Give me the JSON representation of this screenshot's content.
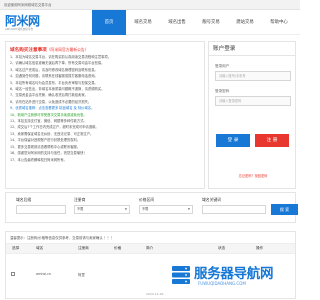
{
  "topbar": {
    "welcome": "欢迎使用阿米网络域名交易平台"
  },
  "header": {
    "logo_main": "阿米网",
    "logo_sub": "AMI.COM  域名交易平台",
    "nav": [
      "首页",
      "域名交易",
      "域名出售",
      "靓号交易",
      "建站交易",
      "帮助中心"
    ],
    "nav_active_index": 0
  },
  "info": {
    "title": "域名购买注意事项",
    "title_sub": "（阿米网官方最新公告）",
    "lines": [
      {
        "t": "1、本站为域名交易平台，请在购买前认真阅读交易流程和注意事项。",
        "c": ""
      },
      {
        "t": "2、请确认域名信息准确无误后再下单，所有交易均由平台担保。",
        "c": ""
      },
      {
        "t": "3、域名过户完成后，请及时修改域名管理密码及联系信息。",
        "c": ""
      },
      {
        "t": "4、如遇到任何问题，请联系在线客服或拨打客服电话咨询。",
        "c": ""
      },
      {
        "t": "5、本站所有域名均为会员发布，平台负责审核与担保交易。",
        "c": ""
      },
      {
        "t": "6、域名一经售出，非域名本身质量问题概不退换，请谨慎购买。",
        "c": ""
      },
      {
        "t": "7、交易资金由平台托管，确认收货后再打款给卖家。",
        "c": ""
      },
      {
        "t": "8、请勿在站外进行交易，以免造成不必要的经济损失。",
        "c": ""
      },
      {
        "t": "9、优质域名推荐：点击查看更多 精品域名 及 特价域名。",
        "c": "blue"
      },
      {
        "t": "10、新用户注册即可享受首次交易手续费减免优惠。",
        "c": "green"
      },
      {
        "t": "11、本站支持支付宝、微信、网银等多种付款方式。",
        "c": ""
      },
      {
        "t": "12、成交后7个工作日内完成过户，超时未完成可申请退款。",
        "c": ""
      },
      {
        "t": "13、卖家需保证域名无纠纷、无违法记录、可正常过户。",
        "c": ""
      },
      {
        "t": "14、平台保留对违规账户进行封禁处理的权利。",
        "c": ""
      },
      {
        "t": "15、更多交易规则请查看帮助中心或联系客服。",
        "c": ""
      },
      {
        "t": "16、感谢您对阿米网的支持与信任，祝您交易愉快！",
        "c": ""
      },
      {
        "t": "17、本公告最终解释权归阿米网所有。",
        "c": ""
      }
    ]
  },
  "login": {
    "title": "账户登录",
    "user_label": "登录用户",
    "user_placeholder": "请输入账号/手机号",
    "pass_label": "登录密码",
    "pass_placeholder": "请输入登录密码",
    "login_btn": "登 录",
    "register_btn": "注 册",
    "forgot": "忘记密码？找回密码"
  },
  "search": {
    "fields": [
      {
        "label": "域名后缀"
      },
      {
        "label": "注册商"
      },
      {
        "label": "价格区间"
      },
      {
        "label": "域名关键词"
      }
    ],
    "select_default": "不限",
    "button": "搜 索"
  },
  "list": {
    "notice": "温馨提示：注册商/价格等信息仅供参考，交易前请与卖家确认 ！！！",
    "columns": [
      "选择",
      "域名",
      "注册商",
      "价格",
      "简介",
      "状态",
      "操作"
    ],
    "rows": [
      {
        "domain": "amiwl.cn",
        "registrar": "阿里",
        "price": "",
        "intro": "",
        "status": "",
        "date": "2024-11-26"
      }
    ]
  },
  "watermark": {
    "text": "服务器导航网",
    "sub": "FUWUQIDAOHANG.COM"
  },
  "colors": {
    "brand_blue": "#1778d6",
    "accent_red": "#e8372f",
    "green": "#29a329"
  }
}
